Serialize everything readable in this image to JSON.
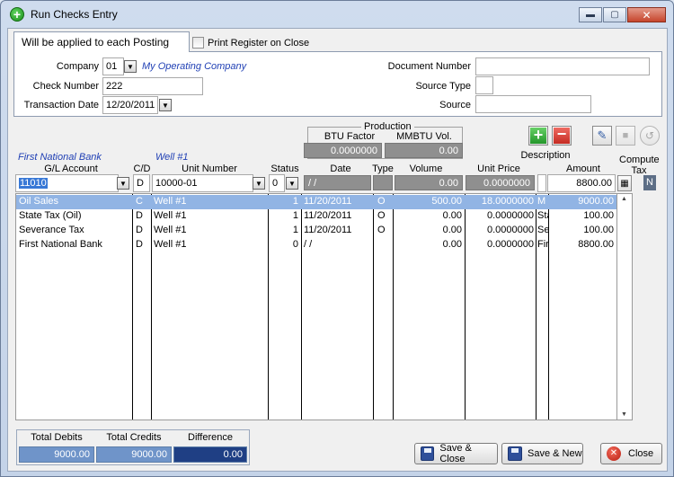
{
  "window": {
    "title": "Run Checks Entry"
  },
  "header": {
    "tab_label": "Will be applied to each Posting",
    "print_register_label": "Print Register on Close",
    "company_label": "Company",
    "company_value": "01",
    "company_name": "My Operating Company",
    "check_number_label": "Check Number",
    "check_number_value": "222",
    "transaction_date_label": "Transaction Date",
    "transaction_date_value": "12/20/2011",
    "document_number_label": "Document Number",
    "document_number_value": "",
    "source_type_label": "Source Type",
    "source_type_value": "",
    "source_label": "Source",
    "source_value": ""
  },
  "production": {
    "title": "Production",
    "btu_label": "BTU Factor",
    "btu_value": "0.0000000",
    "mmbtu_label": "MMBTU Vol.",
    "mmbtu_value": "0.00"
  },
  "entry": {
    "bank_name": "First National Bank",
    "well_name": "Well #1",
    "columns": {
      "gl_account": "G/L Account",
      "cd": "C/D",
      "unit_number": "Unit Number",
      "status": "Status",
      "date": "Date",
      "type": "Type",
      "volume": "Volume",
      "unit_price": "Unit Price",
      "description": "Description",
      "amount": "Amount",
      "compute_tax": "Compute Tax"
    },
    "gl_account_value": "11010",
    "cd_value": "D",
    "unit_number_value": "10000-01",
    "status_value": "0",
    "date_value": "/ /",
    "volume_value": "0.00",
    "unit_price_value": "0.0000000",
    "amount_value": "8800.00",
    "compute_tax_value": "N"
  },
  "grid_rows": [
    {
      "account": "Oil Sales",
      "cd": "C",
      "unit": "Well #1",
      "status": "1",
      "date": "11/20/2011",
      "type": "O",
      "volume": "500.00",
      "price": "18.0000000",
      "desc": "M",
      "amount": "9000.00",
      "selected": true
    },
    {
      "account": "State Tax (Oil)",
      "cd": "D",
      "unit": "Well #1",
      "status": "1",
      "date": "11/20/2011",
      "type": "O",
      "volume": "0.00",
      "price": "0.0000000",
      "desc": "Sta",
      "amount": "100.00",
      "selected": false
    },
    {
      "account": "Severance Tax",
      "cd": "D",
      "unit": "Well #1",
      "status": "1",
      "date": "11/20/2011",
      "type": "O",
      "volume": "0.00",
      "price": "0.0000000",
      "desc": "Se",
      "amount": "100.00",
      "selected": false
    },
    {
      "account": "First National Bank",
      "cd": "D",
      "unit": "Well #1",
      "status": "0",
      "date": "/ /",
      "type": "",
      "volume": "0.00",
      "price": "0.0000000",
      "desc": "Fir",
      "amount": "8800.00",
      "selected": false
    }
  ],
  "totals": {
    "debits_label": "Total Debits",
    "debits_value": "9000.00",
    "credits_label": "Total Credits",
    "credits_value": "9000.00",
    "difference_label": "Difference",
    "difference_value": "0.00"
  },
  "buttons": {
    "save_close": "Save & Close",
    "save_new": "Save & New",
    "close": "Close"
  }
}
